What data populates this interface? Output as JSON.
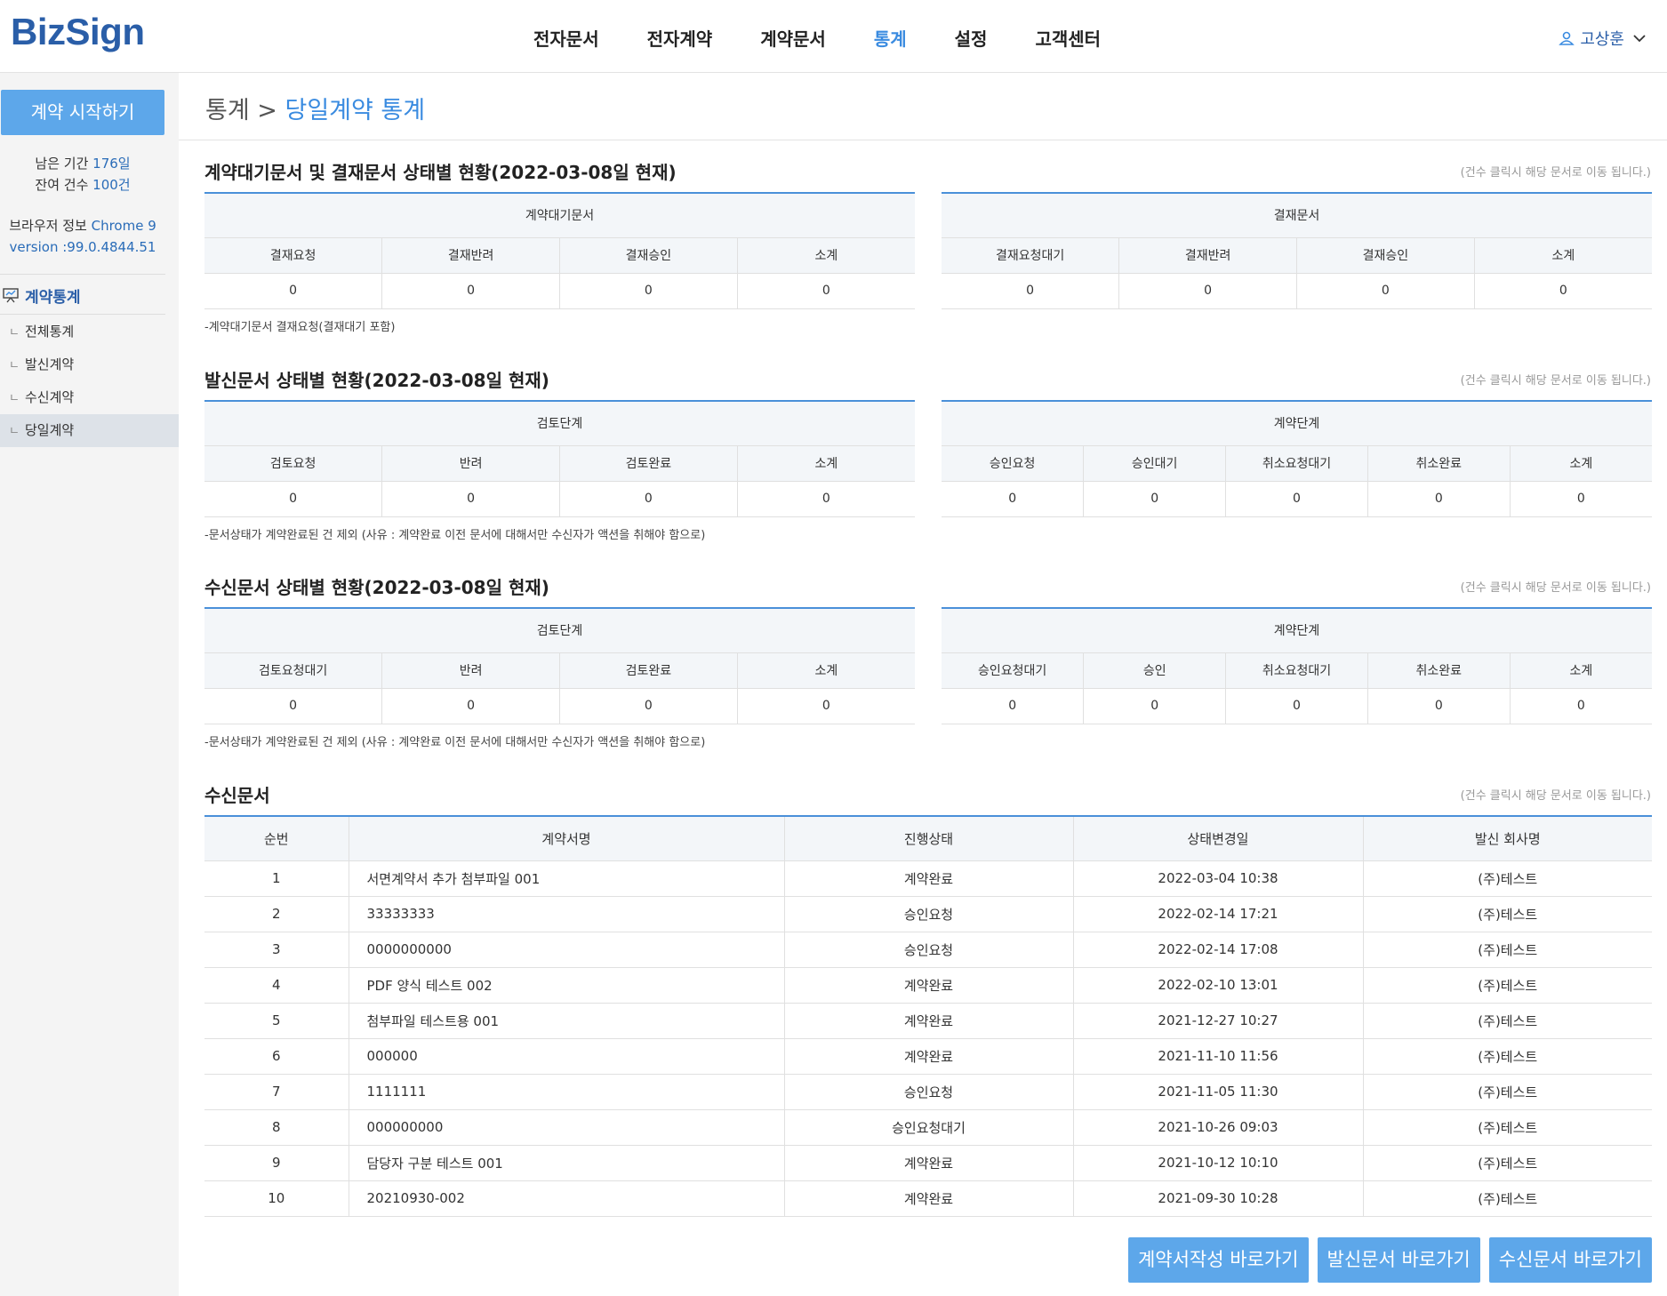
{
  "header": {
    "logo": "BizSign",
    "nav": [
      "전자문서",
      "전자계약",
      "계약문서",
      "통계",
      "설정",
      "고객센터"
    ],
    "active_nav": "통계",
    "user_name": "고상훈"
  },
  "sidebar": {
    "start_button": "계약 시작하기",
    "remaining_period_label": "남은 기간",
    "remaining_period_value": "176일",
    "remaining_count_label": "잔여 건수",
    "remaining_count_value": "100건",
    "browser_label": "브라우저 정보",
    "browser_value": "Chrome 9",
    "version_label": "version :",
    "version_value": "99.0.4844.51",
    "section_title": "계약통계",
    "menu": [
      "전체통계",
      "발신계약",
      "수신계약",
      "당일계약"
    ],
    "active_menu": "당일계약",
    "corner_glyph": "ㄴ"
  },
  "breadcrumb": {
    "parent": "통계",
    "sep": " > ",
    "current": "당일계약 통계"
  },
  "sections": {
    "s1": {
      "title": "계약대기문서 및 결재문서 상태별 현황(2022-03-08일 현재)",
      "note": "(건수 클릭시 해당 문서로 이동 됩니다.)",
      "left": {
        "group": "계약대기문서",
        "headers": [
          "결재요청",
          "결재반려",
          "결재승인",
          "소계"
        ],
        "values": [
          "0",
          "0",
          "0",
          "0"
        ]
      },
      "right": {
        "group": "결재문서",
        "headers": [
          "결재요청대기",
          "결재반려",
          "결재승인",
          "소계"
        ],
        "values": [
          "0",
          "0",
          "0",
          "0"
        ]
      },
      "footnote": "-계약대기문서 결재요청(결재대기 포함)"
    },
    "s2": {
      "title": "발신문서 상태별 현황(2022-03-08일 현재)",
      "note": "(건수 클릭시 해당 문서로 이동 됩니다.)",
      "left": {
        "group": "검토단계",
        "headers": [
          "검토요청",
          "반려",
          "검토완료",
          "소계"
        ],
        "values": [
          "0",
          "0",
          "0",
          "0"
        ]
      },
      "right": {
        "group": "계약단계",
        "headers": [
          "승인요청",
          "승인대기",
          "취소요청대기",
          "취소완료",
          "소계"
        ],
        "values": [
          "0",
          "0",
          "0",
          "0",
          "0"
        ]
      },
      "footnote": "-문서상태가 계약완료된 건 제외 (사유 : 계약완료 이전 문서에 대해서만 수신자가 액션을 취해야 함으로)"
    },
    "s3": {
      "title": "수신문서 상태별 현황(2022-03-08일 현재)",
      "note": "(건수 클릭시 해당 문서로 이동 됩니다.)",
      "left": {
        "group": "검토단계",
        "headers": [
          "검토요청대기",
          "반려",
          "검토완료",
          "소계"
        ],
        "values": [
          "0",
          "0",
          "0",
          "0"
        ]
      },
      "right": {
        "group": "계약단계",
        "headers": [
          "승인요청대기",
          "승인",
          "취소요청대기",
          "취소완료",
          "소계"
        ],
        "values": [
          "0",
          "0",
          "0",
          "0",
          "0"
        ]
      },
      "footnote": "-문서상태가 계약완료된 건 제외 (사유 : 계약완료 이전 문서에 대해서만 수신자가 액션을 취해야 함으로)"
    },
    "s4": {
      "title": "수신문서",
      "note": "(건수 클릭시 해당 문서로 이동 됩니다.)",
      "headers": [
        "순번",
        "계약서명",
        "진행상태",
        "상태변경일",
        "발신 회사명"
      ],
      "rows": [
        [
          "1",
          "서면계약서 추가 첨부파일 001",
          "계약완료",
          "2022-03-04 10:38",
          "(주)테스트"
        ],
        [
          "2",
          "33333333",
          "승인요청",
          "2022-02-14 17:21",
          "(주)테스트"
        ],
        [
          "3",
          "0000000000",
          "승인요청",
          "2022-02-14 17:08",
          "(주)테스트"
        ],
        [
          "4",
          "PDF 양식 테스트 002",
          "계약완료",
          "2022-02-10 13:01",
          "(주)테스트"
        ],
        [
          "5",
          "첨부파일 테스트용 001",
          "계약완료",
          "2021-12-27 10:27",
          "(주)테스트"
        ],
        [
          "6",
          "000000",
          "계약완료",
          "2021-11-10 11:56",
          "(주)테스트"
        ],
        [
          "7",
          "1111111",
          "승인요청",
          "2021-11-05 11:30",
          "(주)테스트"
        ],
        [
          "8",
          "000000000",
          "승인요청대기",
          "2021-10-26 09:03",
          "(주)테스트"
        ],
        [
          "9",
          "담당자 구분 테스트 001",
          "계약완료",
          "2021-10-12 10:10",
          "(주)테스트"
        ],
        [
          "10",
          "20210930-002",
          "계약완료",
          "2021-09-30 10:28",
          "(주)테스트"
        ]
      ]
    }
  },
  "buttons": [
    "계약서작성 바로가기",
    "발신문서 바로가기",
    "수신문서 바로가기"
  ]
}
